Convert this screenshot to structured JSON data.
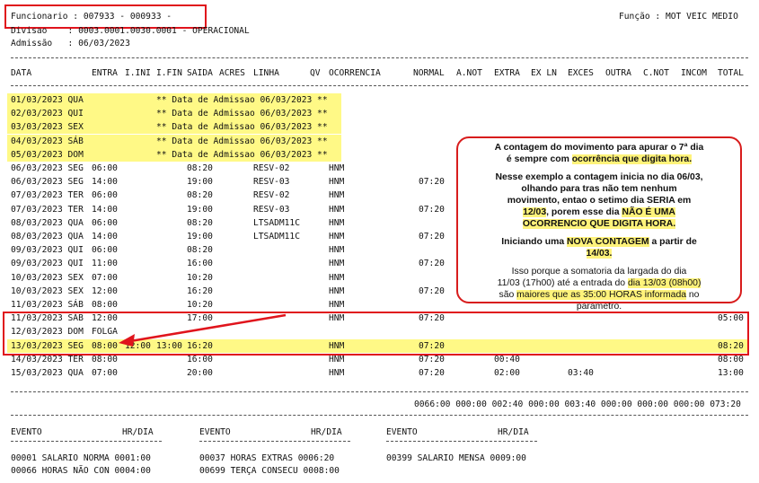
{
  "header": {
    "funcionario": "Funcionario : 007933 - 000933 -",
    "funcao": "Função : MOT VEIC MEDIO",
    "divisao": "Divisao    : 0003.0001.0030.0001 - OPERACIONAL",
    "admissao": "Admissão   : 06/03/2023"
  },
  "columns": {
    "data": "DATA",
    "entra": "ENTRA",
    "i_ini": "I.INI",
    "i_fin": "I.FIN",
    "saida": "SAIDA",
    "acres": "ACRES",
    "linha": "LINHA",
    "qv": "QV",
    "ocorrencia": "OCORRENCIA",
    "normal": "NORMAL",
    "a_not": "A.NOT",
    "extra": "EXTRA",
    "ex_ln": "EX LN",
    "exces": "EXCES",
    "outra": "OUTRA",
    "c_not": "C.NOT",
    "incom": "INCOM",
    "total": "TOTAL"
  },
  "rows": [
    {
      "date": "01/03/2023 QUA",
      "note": "** Data de Admissao 06/03/2023 **",
      "hl": true
    },
    {
      "date": "02/03/2023 QUI",
      "note": "** Data de Admissao 06/03/2023 **",
      "hl": true
    },
    {
      "date": "03/03/2023 SEX",
      "note": "** Data de Admissao 06/03/2023 **",
      "hl": true
    },
    {
      "date": "04/03/2023 SÁB",
      "note": "** Data de Admissao 06/03/2023 **",
      "hl": true
    },
    {
      "date": "05/03/2023 DOM",
      "note": "** Data de Admissao 06/03/2023 **",
      "hl": true
    },
    {
      "date": "06/03/2023 SEG",
      "entra": "06:00",
      "saida": "08:20",
      "linha": "RESV-02",
      "occ": "HNM"
    },
    {
      "date": "06/03/2023 SEG",
      "entra": "14:00",
      "saida": "19:00",
      "linha": "RESV-03",
      "occ": "HNM",
      "normal": "07:20"
    },
    {
      "date": "07/03/2023 TER",
      "entra": "06:00",
      "saida": "08:20",
      "linha": "RESV-02",
      "occ": "HNM"
    },
    {
      "date": "07/03/2023 TER",
      "entra": "14:00",
      "saida": "19:00",
      "linha": "RESV-03",
      "occ": "HNM",
      "normal": "07:20"
    },
    {
      "date": "08/03/2023 QUA",
      "entra": "06:00",
      "saida": "08:20",
      "linha": "LTSADM11C",
      "occ": "HNM"
    },
    {
      "date": "08/03/2023 QUA",
      "entra": "14:00",
      "saida": "19:00",
      "linha": "LTSADM11C",
      "occ": "HNM",
      "normal": "07:20"
    },
    {
      "date": "09/03/2023 QUI",
      "entra": "06:00",
      "saida": "08:20",
      "occ": "HNM"
    },
    {
      "date": "09/03/2023 QUI",
      "entra": "11:00",
      "saida": "16:00",
      "occ": "HNM",
      "normal": "07:20"
    },
    {
      "date": "10/03/2023 SEX",
      "entra": "07:00",
      "saida": "10:20",
      "occ": "HNM"
    },
    {
      "date": "10/03/2023 SEX",
      "entra": "12:00",
      "saida": "16:20",
      "occ": "HNM",
      "normal": "07:20"
    },
    {
      "date": "11/03/2023 SÁB",
      "entra": "08:00",
      "saida": "10:20",
      "occ": "HNM"
    },
    {
      "date": "11/03/2023 SÁB",
      "entra": "12:00",
      "saida": "17:00",
      "occ": "HNM",
      "normal": "07:20",
      "total": "05:00",
      "boxed": true
    },
    {
      "date": "12/03/2023 DOM",
      "entra": "FOLGA",
      "boxed": true
    },
    {
      "date": "13/03/2023 SEG",
      "entra": "08:00",
      "i_ini": "12:00",
      "i_fin": "13:00",
      "saida": "16:20",
      "occ": "HNM",
      "normal": "07:20",
      "total": "08:20",
      "hl": true,
      "boxed": true
    },
    {
      "date": "14/03/2023 TER",
      "entra": "08:00",
      "saida": "16:00",
      "occ": "HNM",
      "normal": "07:20",
      "extra": "00:40",
      "total": "08:00"
    },
    {
      "date": "15/03/2023 QUA",
      "entra": "07:00",
      "saida": "20:00",
      "occ": "HNM",
      "normal": "07:20",
      "extra": "02:00",
      "exces": "03:40",
      "total": "13:00"
    }
  ],
  "totals": "0066:00 000:00 002:40 000:00 003:40 000:00 000:00 000:00 073:20",
  "events": {
    "headers": [
      {
        "evento": "EVENTO",
        "hr": "HR/DIA"
      },
      {
        "evento": "EVENTO",
        "hr": "HR/DIA"
      },
      {
        "evento": "EVENTO",
        "hr": "HR/DIA"
      }
    ],
    "lines": [
      {
        "a": "00001 SALARIO NORMA 0001:00",
        "b": "00037 HORAS EXTRAS 0006:20",
        "c": "00399 SALARIO MENSA 0009:00"
      },
      {
        "a": "00066 HORAS NÃO CON 0004:00",
        "b": "00699 TERÇA CONSECU 0008:00"
      }
    ]
  },
  "callout": {
    "p1a": "A contagem do movimento para apurar o 7ª dia",
    "p1b": "é sempre com ",
    "p1c": "ocorrência que digita hora.",
    "p2a": "Nesse exemplo a contagem inicia no dia 06/03,",
    "p2b": "olhando para tras não tem nenhum",
    "p2c": "movimento, entao o setimo dia SERIA em",
    "p2d": "12/03",
    "p2e": ", porem esse dia ",
    "p2f": "NÃO É UMA",
    "p2g": "OCORRENCIO QUE DIGITA HORA.",
    "p3a": "Iniciando uma ",
    "p3b": "NOVA CONTAGEM",
    "p3c": " a partir de",
    "p3d": "14/03.",
    "p4a": "Isso porque a somatoria da largada do dia",
    "p4b": "11/03 (17h00) até a entrada do ",
    "p4c": "dia 13/03 (08h00)",
    "p4d": "são ",
    "p4e": "maiores que as 35:00 HORAS informada",
    "p4f": " no",
    "p4g": "parametro."
  },
  "colors": {
    "highlight": "#fff986",
    "red": "#e0141c"
  }
}
